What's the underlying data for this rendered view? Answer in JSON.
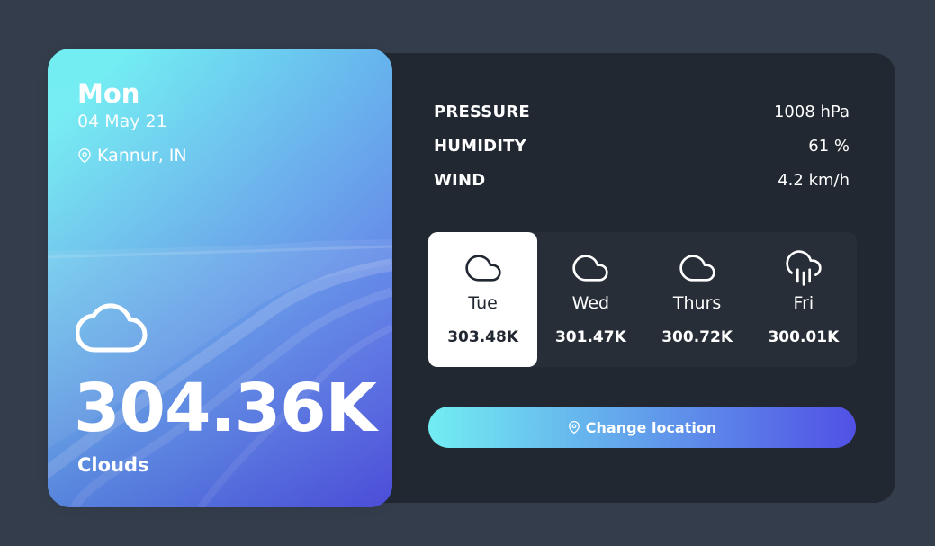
{
  "today": {
    "day": "Mon",
    "date": "04 May 21",
    "location": "Kannur, IN",
    "temperature": "304.36K",
    "description": "Clouds",
    "icon": "cloud-icon"
  },
  "stats": [
    {
      "name": "PRESSURE",
      "value": "1008 hPa"
    },
    {
      "name": "HUMIDITY",
      "value": "61 %"
    },
    {
      "name": "WIND",
      "value": "4.2 km/h"
    }
  ],
  "week": [
    {
      "day": "Tue",
      "temp": "303.48K",
      "icon": "cloud-icon",
      "active": true
    },
    {
      "day": "Wed",
      "temp": "301.47K",
      "icon": "cloud-icon",
      "active": false
    },
    {
      "day": "Thurs",
      "temp": "300.72K",
      "icon": "cloud-icon",
      "active": false
    },
    {
      "day": "Fri",
      "temp": "300.01K",
      "icon": "cloud-rain-icon",
      "active": false
    }
  ],
  "button": {
    "label": "Change location",
    "icon": "map-pin-icon"
  },
  "colors": {
    "background": "#343d4b",
    "panel": "#222831",
    "gradient_start": "#72edf2",
    "gradient_end": "#5151e5",
    "text": "#ffffff"
  }
}
